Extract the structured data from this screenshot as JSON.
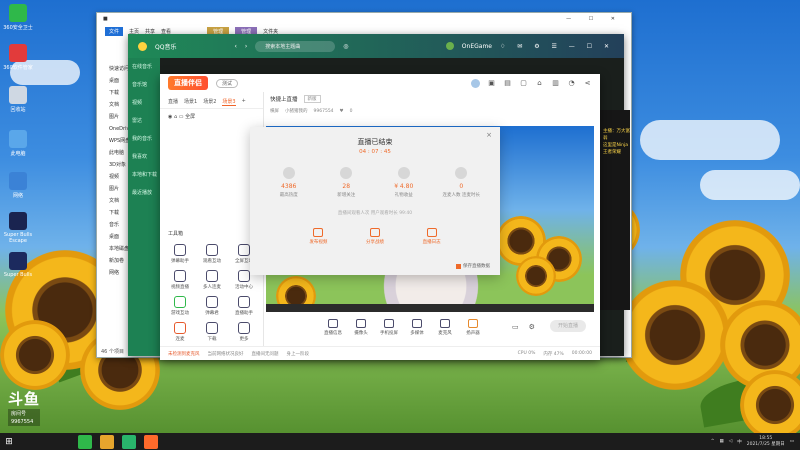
{
  "desktop": {
    "icons": [
      {
        "label": "360安全卫士"
      },
      {
        "label": "360软件管家"
      },
      {
        "label": "回收站"
      },
      {
        "label": "此电脑"
      },
      {
        "label": "网络"
      },
      {
        "label": "Super Bulls Escape"
      },
      {
        "label": "Super Bulls"
      }
    ]
  },
  "explorer": {
    "menu": [
      "文件",
      "主页",
      "共享",
      "查看"
    ],
    "tabs": [
      "管理",
      "管理",
      "文件夹"
    ],
    "sidebar": [
      "快速访问",
      "桌面",
      "下载",
      "文档",
      "图片",
      "OneDrive",
      "WPS网盘",
      "此电脑",
      "3D对象",
      "视频",
      "图片",
      "文档",
      "下载",
      "音乐",
      "桌面",
      "本地磁盘",
      "新加卷",
      "网络"
    ],
    "status": "46 个项目"
  },
  "qqmusic": {
    "title": "QQ音乐",
    "search_placeholder": "搜索本地主题曲",
    "user": "OnEGame",
    "sidebar": [
      "在线音乐",
      "音乐馆",
      "视频",
      "雷达",
      "我的音乐",
      "我喜欢",
      "本地和下载",
      "最近播放"
    ]
  },
  "streamer": {
    "logo": "直播伴侣",
    "version": "测试",
    "title": "快捷上直播",
    "title_tag": "新版",
    "sub": [
      "横屏",
      "小猪猪我的",
      "9967554",
      "0"
    ],
    "scene_tabs": [
      "直播",
      "场景1",
      "场景2",
      "场景3"
    ],
    "scene_item": "全屏",
    "tools_title": "工具箱",
    "tools": [
      "弹幕助手",
      "观看互动",
      "全屏互动",
      "视频直播",
      "多人连麦",
      "活动中心",
      "游戏互动",
      "弹幕君",
      "直播助手",
      "连麦",
      "下载",
      "更多"
    ],
    "toolbar": [
      "直播信息",
      "摄像头",
      "手机投屏",
      "多媒体",
      "麦克风",
      "扬声器"
    ],
    "start_button": "开始直播",
    "status": [
      "未检测到麦克风",
      "当前网络状况良好",
      "直播间无问题",
      "身上一阶段",
      "CPU 0%",
      "内存 47%",
      "00:00:00"
    ],
    "status_warn": "未检测到麦克风"
  },
  "modal": {
    "title": "直播已结束",
    "duration": "04 : 07 : 45",
    "close": "×",
    "stats": [
      {
        "value": "4386",
        "label": "最高热度"
      },
      {
        "value": "28",
        "label": "新增关注"
      },
      {
        "value": "¥ 4.80",
        "label": "礼物收益"
      },
      {
        "value": "0",
        "label": "连麦人数\n连麦时长"
      }
    ],
    "note": "直播间观看人次  用户观看时长 99:40",
    "actions": [
      "发布视频",
      "分享战绩",
      "直播日志"
    ],
    "save_label": "保存直播数据"
  },
  "rightpanel": {
    "text": [
      "主播：万大富翁",
      "这里是Ninja王者荣耀"
    ]
  },
  "watermark": {
    "logo": "斗鱼",
    "label": "房间号",
    "room": "9967554"
  },
  "taskbar": {
    "time": "18:55",
    "date": "2021/7/25 星期日",
    "lang": "中"
  }
}
